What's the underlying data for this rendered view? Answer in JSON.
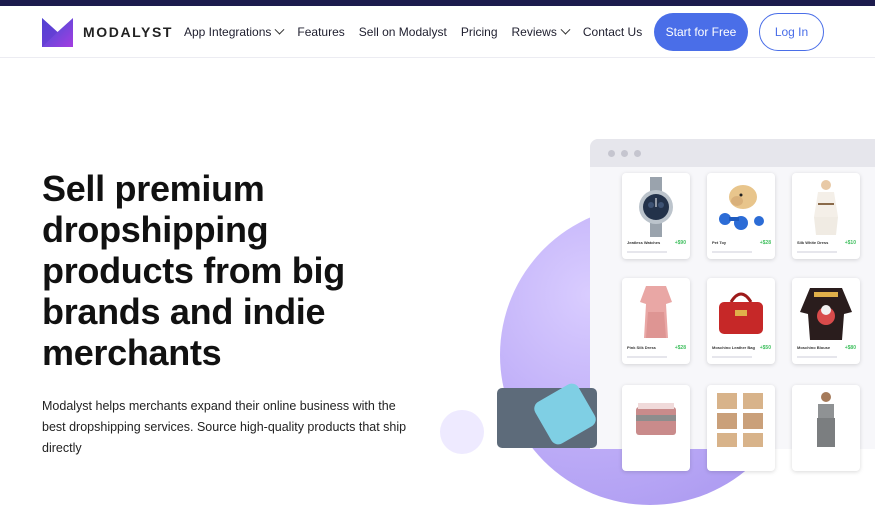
{
  "brand": {
    "name": "MODALYST"
  },
  "nav": {
    "items": [
      {
        "label": "App Integrations",
        "dropdown": true
      },
      {
        "label": "Features",
        "dropdown": false
      },
      {
        "label": "Sell on Modalyst",
        "dropdown": false
      },
      {
        "label": "Pricing",
        "dropdown": false
      },
      {
        "label": "Reviews",
        "dropdown": true
      },
      {
        "label": "Contact Us",
        "dropdown": false
      }
    ],
    "start_label": "Start for Free",
    "login_label": "Log In"
  },
  "hero": {
    "title": "Sell premium dropshipping products from big brands and indie merchants",
    "description": "Modalyst helps merchants expand their online business with the best dropshipping services. Source high-quality products that ship directly"
  },
  "products": [
    {
      "name": "Jeatless Watches",
      "price": "+$90"
    },
    {
      "name": "Pet Toy",
      "price": "+$28"
    },
    {
      "name": "Silk White Dress",
      "price": "+$10"
    },
    {
      "name": "Pink Silk Dress",
      "price": "+$28"
    },
    {
      "name": "Moschino Leather Bag",
      "price": "+$50"
    },
    {
      "name": "Moschino Blouse",
      "price": "+$80"
    },
    {
      "name": "",
      "price": ""
    },
    {
      "name": "",
      "price": ""
    },
    {
      "name": "",
      "price": ""
    }
  ],
  "colors": {
    "accent": "#4a6ee8",
    "topbar": "#1c1b4d",
    "price": "#3fbf5e"
  }
}
